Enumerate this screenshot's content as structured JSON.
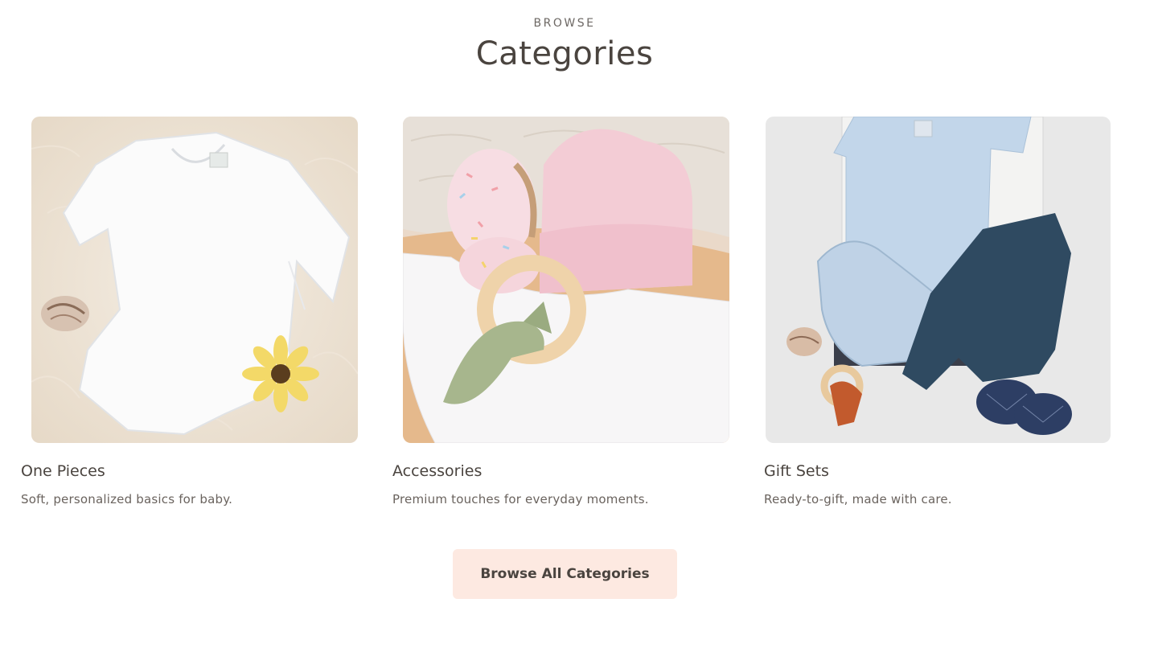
{
  "header": {
    "eyebrow": "BROWSE",
    "title": "Categories"
  },
  "categories": [
    {
      "name": "One Pieces",
      "description": "Soft, personalized basics for baby.",
      "image": "white long-sleeve bodysuit on sheepskin rug with shell and yellow flower"
    },
    {
      "name": "Accessories",
      "description": "Premium touches for everyday moments.",
      "image": "pink hat, sprinkle booties, white bib and wooden teether ring"
    },
    {
      "name": "Gift Sets",
      "description": "Ready-to-gift, made with care.",
      "image": "light blue bodysuit and bib, navy pants, shoes and teether in gift box"
    }
  ],
  "cta": {
    "label": "Browse All Categories"
  },
  "colors": {
    "button_bg": "#fde9e1",
    "heading": "#4a443f",
    "body_text": "#6a635e"
  }
}
